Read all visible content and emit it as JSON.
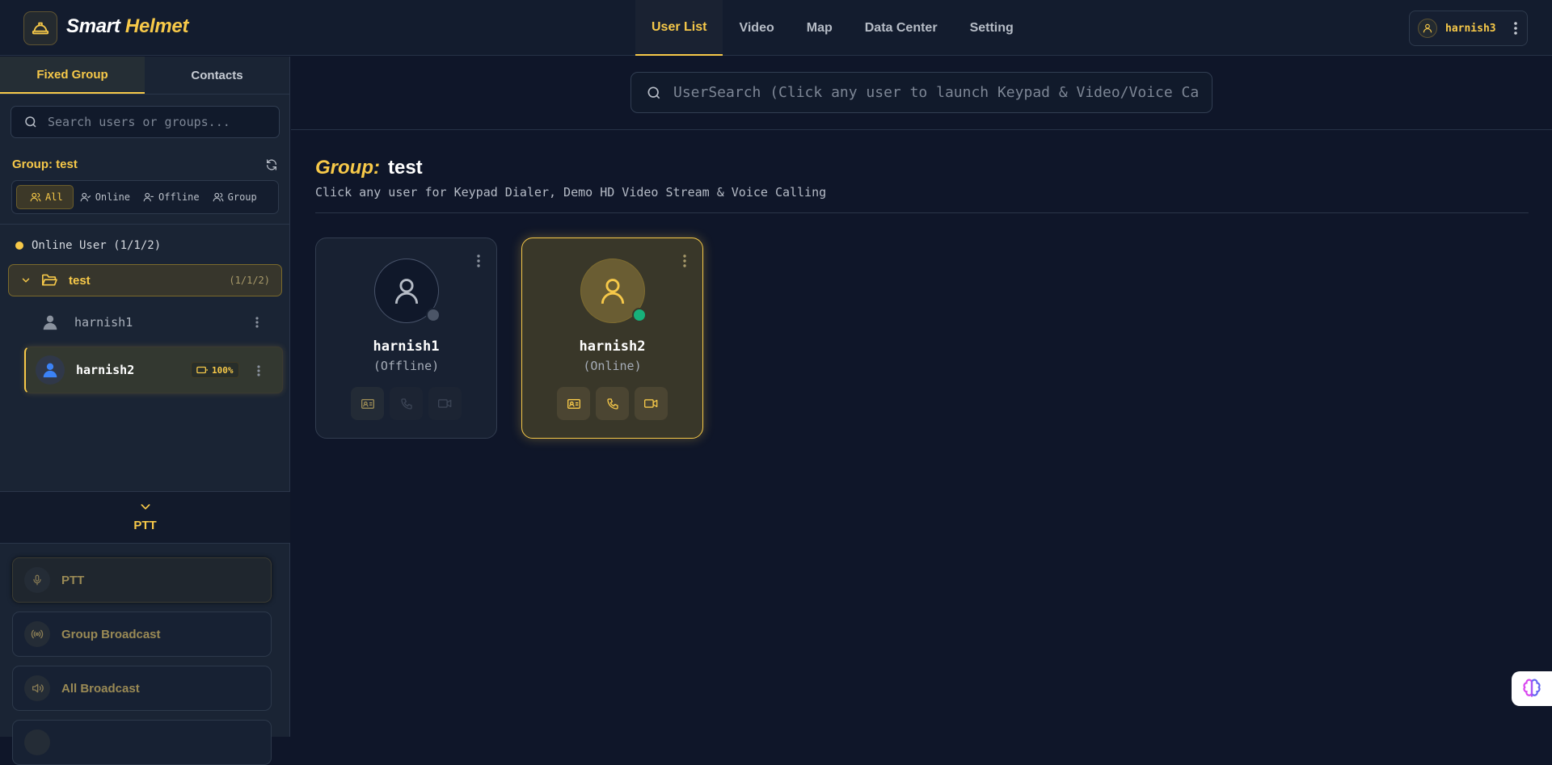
{
  "app": {
    "brand_part1": "Smart",
    "brand_part2": "Helmet"
  },
  "nav": {
    "items": [
      "User List",
      "Video",
      "Map",
      "Data Center",
      "Setting"
    ],
    "active": "User List"
  },
  "account": {
    "username": "harnish3"
  },
  "sidebar": {
    "tabs": [
      "Fixed Group",
      "Contacts"
    ],
    "search_placeholder": "Search users or groups...",
    "group_title": "Group: test",
    "filters": [
      "All",
      "Online",
      "Offline",
      "Group"
    ],
    "online_header": "Online User (1/1/2)",
    "group": {
      "name": "test",
      "count": "(1/1/2)"
    },
    "users": [
      {
        "name": "harnish1",
        "status": "offline"
      },
      {
        "name": "harnish2",
        "status": "online",
        "battery": "100%"
      }
    ],
    "ptt_header": "PTT",
    "ptt_buttons": [
      "PTT",
      "Group Broadcast",
      "All Broadcast"
    ]
  },
  "main": {
    "search_placeholder": "UserSearch (Click any user to launch Keypad & Video/Voice Call",
    "group_label": "Group:",
    "group_name": "test",
    "subtitle": "Click any user for Keypad Dialer, Demo HD Video Stream & Voice Calling",
    "cards": [
      {
        "name": "harnish1",
        "status": "(Offline)"
      },
      {
        "name": "harnish2",
        "status": "(Online)"
      }
    ]
  },
  "colors": {
    "accent": "#f7c949",
    "online": "#17b07a",
    "offline": "#4b5567",
    "background": "#0f1629"
  }
}
